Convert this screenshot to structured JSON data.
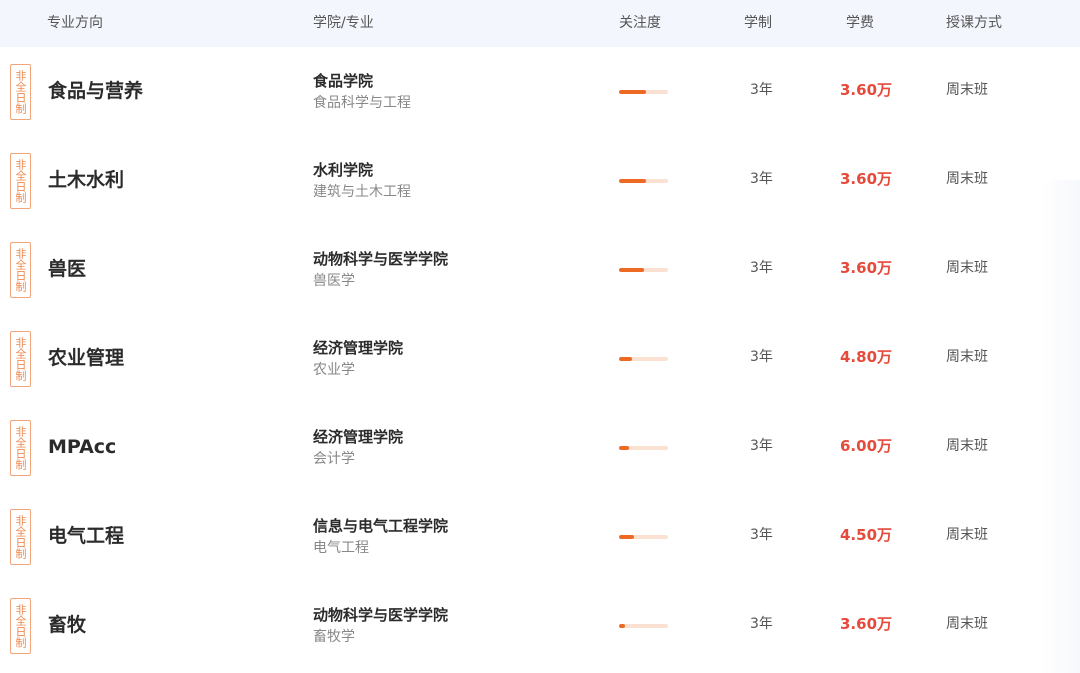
{
  "header": {
    "major": "专业方向",
    "college": "学院/专业",
    "attention": "关注度",
    "duration": "学制",
    "fee": "学费",
    "mode": "授课方式"
  },
  "rows": [
    {
      "tag": "非全日制",
      "major": "食品与营养",
      "college": "食品学院",
      "subject": "食品科学与工程",
      "attention": 0.55,
      "duration": "3年",
      "fee": "3.60万",
      "mode": "周末班"
    },
    {
      "tag": "非全日制",
      "major": "土木水利",
      "college": "水利学院",
      "subject": "建筑与土木工程",
      "attention": 0.55,
      "duration": "3年",
      "fee": "3.60万",
      "mode": "周末班"
    },
    {
      "tag": "非全日制",
      "major": "兽医",
      "college": "动物科学与医学学院",
      "subject": "兽医学",
      "attention": 0.5,
      "duration": "3年",
      "fee": "3.60万",
      "mode": "周末班"
    },
    {
      "tag": "非全日制",
      "major": "农业管理",
      "college": "经济管理学院",
      "subject": "农业学",
      "attention": 0.27,
      "duration": "3年",
      "fee": "4.80万",
      "mode": "周末班"
    },
    {
      "tag": "非全日制",
      "major": "MPAcc",
      "college": "经济管理学院",
      "subject": "会计学",
      "attention": 0.2,
      "duration": "3年",
      "fee": "6.00万",
      "mode": "周末班"
    },
    {
      "tag": "非全日制",
      "major": "电气工程",
      "college": "信息与电气工程学院",
      "subject": "电气工程",
      "attention": 0.3,
      "duration": "3年",
      "fee": "4.50万",
      "mode": "周末班"
    },
    {
      "tag": "非全日制",
      "major": "畜牧",
      "college": "动物科学与医学学院",
      "subject": "畜牧学",
      "attention": 0.12,
      "duration": "3年",
      "fee": "3.60万",
      "mode": "周末班"
    }
  ]
}
